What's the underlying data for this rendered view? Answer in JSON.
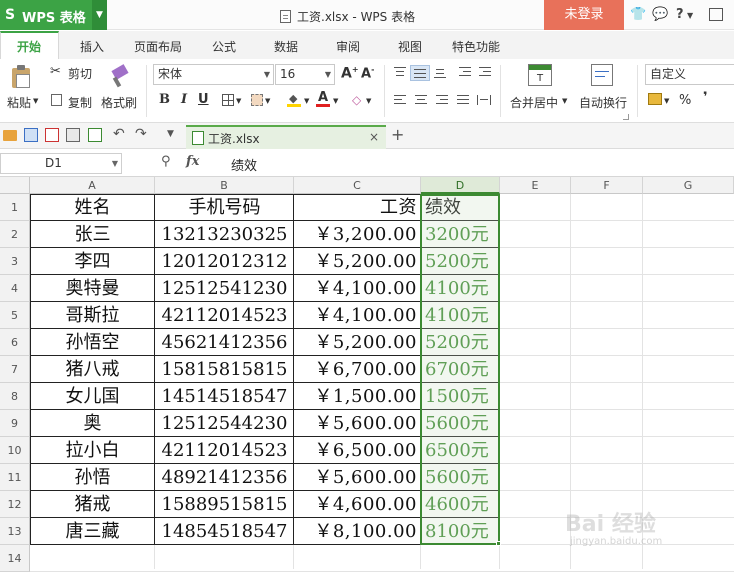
{
  "app": {
    "name": "WPS 表格",
    "window_title": "工资.xlsx - WPS 表格",
    "login_label": "未登录",
    "help_label": "?"
  },
  "ribbon": {
    "tabs": [
      {
        "label": "开始",
        "active": true
      },
      {
        "label": "插入"
      },
      {
        "label": "页面布局"
      },
      {
        "label": "公式"
      },
      {
        "label": "数据"
      },
      {
        "label": "审阅"
      },
      {
        "label": "视图"
      },
      {
        "label": "特色功能"
      }
    ]
  },
  "toolbar": {
    "paste_label": "粘贴",
    "cut_label": "剪切",
    "copy_label": "复制",
    "format_painter_label": "格式刷",
    "font_name": "宋体",
    "font_size": "16",
    "merge_center_label": "合并居中",
    "wrap_text_label": "自动换行",
    "number_format": "自定义",
    "percent_symbol": "%"
  },
  "document_tab": {
    "label": "工资.xlsx"
  },
  "formula_bar": {
    "cell_ref": "D1",
    "fx_label": "fx",
    "content": "绩效"
  },
  "sheet": {
    "columns": [
      "A",
      "B",
      "C",
      "D",
      "E",
      "F",
      "G"
    ],
    "selected_column": "D",
    "headers": [
      "姓名",
      "手机号码",
      "工资",
      "绩效"
    ],
    "rows": [
      [
        "张三",
        "13213230325",
        "￥3,200.00",
        "3200元"
      ],
      [
        "李四",
        "12012012312",
        "￥5,200.00",
        "5200元"
      ],
      [
        "奥特曼",
        "12512541230",
        "￥4,100.00",
        "4100元"
      ],
      [
        "哥斯拉",
        "42112014523",
        "￥4,100.00",
        "4100元"
      ],
      [
        "孙悟空",
        "45621412356",
        "￥5,200.00",
        "5200元"
      ],
      [
        "猪八戒",
        "15815815815",
        "￥6,700.00",
        "6700元"
      ],
      [
        "女儿国",
        "14514518547",
        "￥1,500.00",
        "1500元"
      ],
      [
        "奥",
        "12512544230",
        "￥5,600.00",
        "5600元"
      ],
      [
        "拉小白",
        "42112014523",
        "￥6,500.00",
        "6500元"
      ],
      [
        "孙悟",
        "48921412356",
        "￥5,600.00",
        "5600元"
      ],
      [
        "猪戒",
        "15889515815",
        "￥4,600.00",
        "4600元"
      ],
      [
        "唐三藏",
        "14854518547",
        "￥8,100.00",
        "8100元"
      ]
    ],
    "row_numbers": [
      "1",
      "2",
      "3",
      "4",
      "5",
      "6",
      "7",
      "8",
      "9",
      "10",
      "11",
      "12",
      "13",
      "14"
    ]
  },
  "watermark": {
    "text": "Bai 经验",
    "url_text": "jingyan.baidu.com"
  },
  "colors": {
    "accent_green": "#3ca345",
    "login_bg": "#e8715a",
    "selection_border": "#3c8a32",
    "green_text": "#3c8a32"
  }
}
